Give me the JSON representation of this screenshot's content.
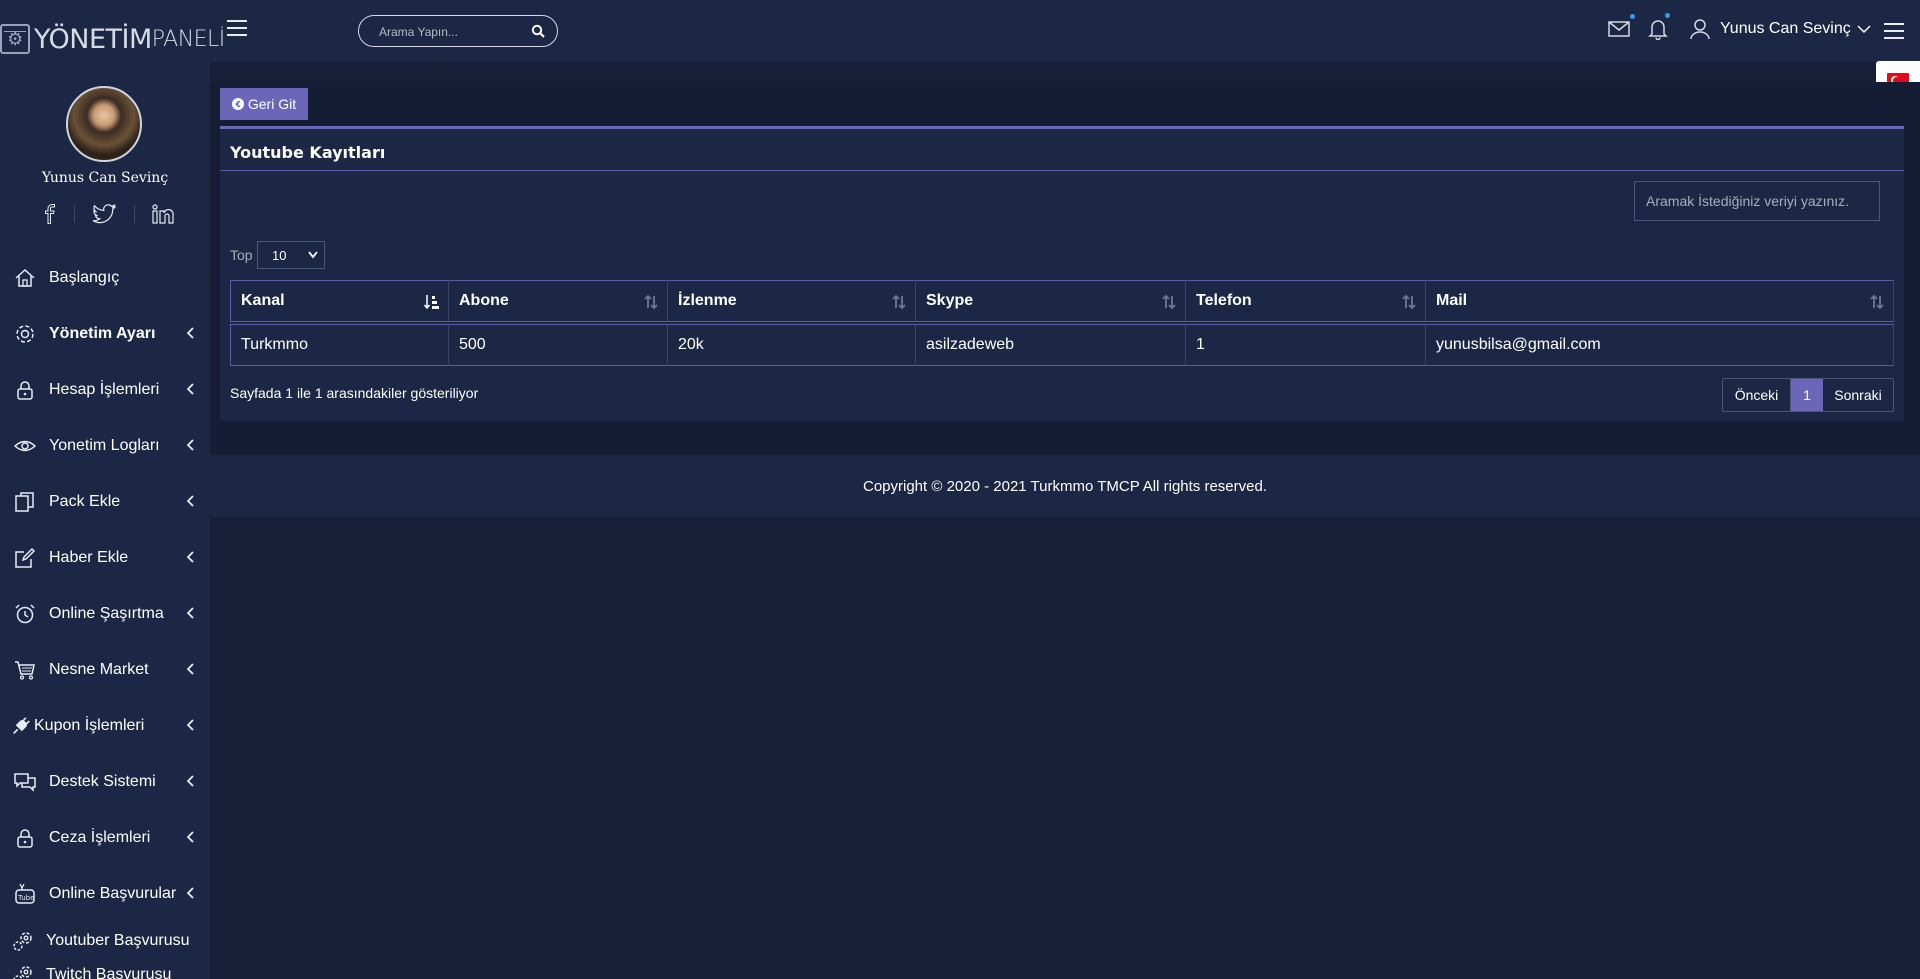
{
  "header": {
    "logo_bold": "YÖNETİM",
    "logo_light": "PANELİ",
    "search_placeholder": "Arama Yapın...",
    "user_name": "Yunus Can Sevinç"
  },
  "sidebar": {
    "user_name": "Yunus Can Sevinç",
    "items": [
      {
        "label": "Başlangıç",
        "icon": "home-icon"
      },
      {
        "label": "Yönetim Ayarı",
        "icon": "gear-icon"
      },
      {
        "label": "Hesap İşlemleri",
        "icon": "lock-icon"
      },
      {
        "label": "Yonetim Logları",
        "icon": "eye-icon"
      },
      {
        "label": "Pack Ekle",
        "icon": "copy-icon"
      },
      {
        "label": "Haber Ekle",
        "icon": "edit-icon"
      },
      {
        "label": "Online Şaşırtma",
        "icon": "alarm-clock-icon"
      },
      {
        "label": "Nesne Market",
        "icon": "cart-icon"
      },
      {
        "label": "Kupon İşlemleri",
        "icon": "plug-icon"
      },
      {
        "label": "Destek Sistemi",
        "icon": "chat-icon"
      },
      {
        "label": "Ceza İşlemleri",
        "icon": "lock-icon"
      },
      {
        "label": "Online Başvurular",
        "icon": "youtube-icon"
      },
      {
        "label": "Youtuber Başvurusu",
        "icon": "gears-icon"
      },
      {
        "label": "Twitch Başvurusu",
        "icon": "gears-icon"
      }
    ]
  },
  "content": {
    "back_label": "Geri Git",
    "card_title": "Youtube Kayıtları",
    "filter_placeholder": "Aramak İstediğiniz veriyi yazınız.",
    "top_label": "Top",
    "page_size": "10",
    "columns": [
      "Kanal",
      "Abone",
      "İzlenme",
      "Skype",
      "Telefon",
      "Mail"
    ],
    "rows": [
      [
        "Turkmmo",
        "500",
        "20k",
        "asilzadeweb",
        "1",
        "yunusbilsa@gmail.com"
      ]
    ],
    "info": "Sayfada 1 ile 1 arasındakiler gösteriliyor",
    "pager": {
      "prev": "Önceki",
      "current": "1",
      "next": "Sonraki"
    }
  },
  "footer": {
    "copyright": "Copyright © 2020 - 2021 Turkmmo TMCP All rights reserved."
  },
  "colors": {
    "background": "#172038",
    "panel": "#1b2744",
    "accent": "#6c66b8"
  }
}
